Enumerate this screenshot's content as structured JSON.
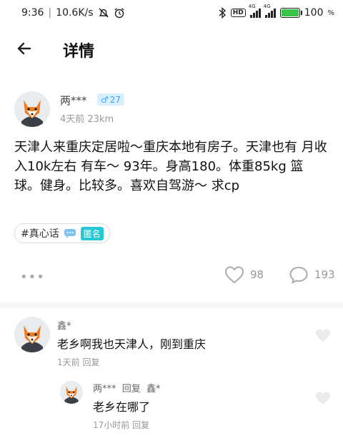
{
  "status_bar": {
    "time": "9:36",
    "net_speed": "10.6K/s",
    "hd": "HD",
    "net1": "4G",
    "net2": "4G",
    "battery": "100",
    "battery_pct": 100
  },
  "nav": {
    "title": "详情"
  },
  "post": {
    "author": "两***",
    "gender_age": "27",
    "meta": "4天前  23km",
    "text": "天津人来重庆定居啦～重庆本地有房子。天津也有 月收入10k左右   有车～ 93年。身高180。体重85kg  篮球。健身。比较多。喜欢自驾游～ 求cp",
    "tag": "#真心话",
    "anon": "匿名",
    "likes": "98",
    "comments": "193"
  },
  "comments": [
    {
      "name": "鑫*",
      "text": "老乡啊我也天津人，刚到重庆",
      "meta": "1天前  回复"
    },
    {
      "name": "两***  回复  鑫*",
      "text": "老乡在哪了",
      "meta": "17小时前  回复"
    }
  ]
}
